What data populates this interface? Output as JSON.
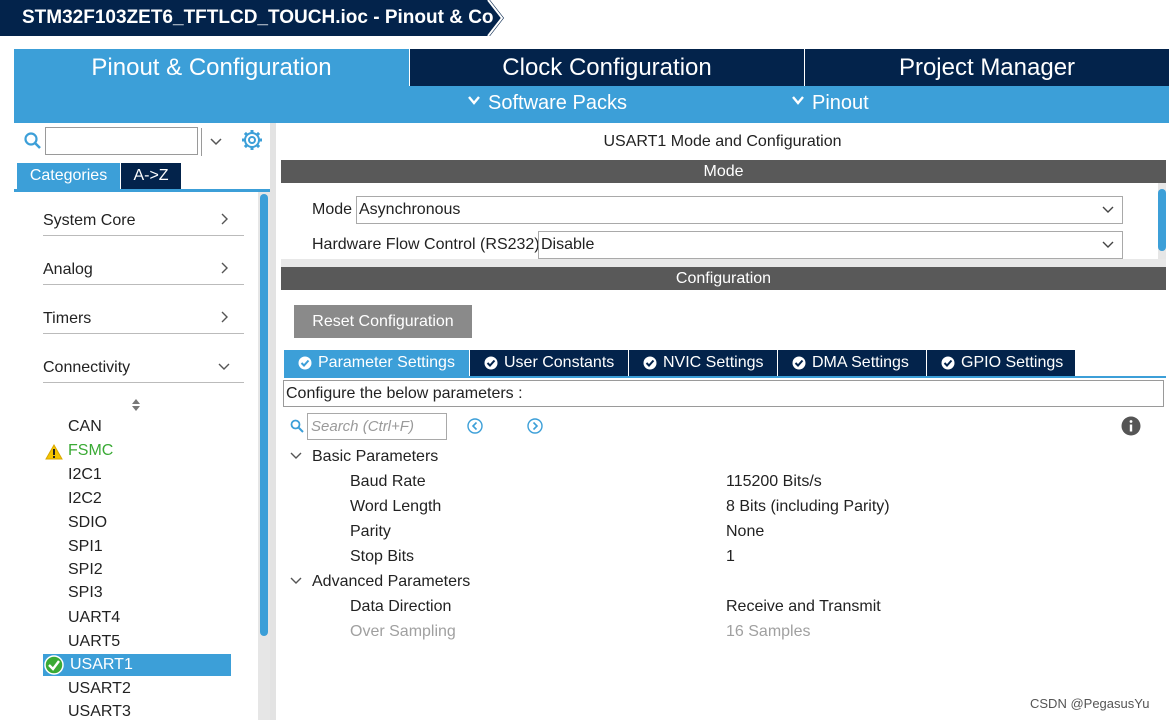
{
  "window": {
    "title": "STM32F103ZET6_TFTLCD_TOUCH.ioc - Pinout & Co"
  },
  "main_tabs": [
    {
      "label": "Pinout & Configuration",
      "active": true
    },
    {
      "label": "Clock Configuration",
      "active": false
    },
    {
      "label": "Project Manager",
      "active": false
    }
  ],
  "sub_bar": {
    "software_packs": "Software Packs",
    "pinout": "Pinout"
  },
  "left_panel": {
    "search_value": "",
    "tabs": {
      "categories": "Categories",
      "az": "A->Z"
    },
    "categories": [
      {
        "label": "System Core",
        "expanded": false
      },
      {
        "label": "Analog",
        "expanded": false
      },
      {
        "label": "Timers",
        "expanded": false
      },
      {
        "label": "Connectivity",
        "expanded": true
      }
    ],
    "connectivity_items": [
      {
        "label": "CAN",
        "status": "none"
      },
      {
        "label": "FSMC",
        "status": "warning"
      },
      {
        "label": "I2C1",
        "status": "none"
      },
      {
        "label": "I2C2",
        "status": "none"
      },
      {
        "label": "SDIO",
        "status": "none"
      },
      {
        "label": "SPI1",
        "status": "none"
      },
      {
        "label": "SPI2",
        "status": "none"
      },
      {
        "label": "SPI3",
        "status": "none"
      },
      {
        "label": "UART4",
        "status": "none"
      },
      {
        "label": "UART5",
        "status": "none"
      },
      {
        "label": "USART1",
        "status": "enabled"
      },
      {
        "label": "USART2",
        "status": "none"
      },
      {
        "label": "USART3",
        "status": "none"
      }
    ]
  },
  "config": {
    "title": "USART1 Mode and Configuration",
    "mode_header": "Mode",
    "mode_label": "Mode",
    "mode_value": "Asynchronous",
    "hfc_label": "Hardware Flow Control (RS232)",
    "hfc_value": "Disable",
    "configuration_header": "Configuration",
    "reset_button": "Reset Configuration",
    "tabs": [
      {
        "label": "Parameter Settings",
        "active": true
      },
      {
        "label": "User Constants",
        "active": false
      },
      {
        "label": "NVIC Settings",
        "active": false
      },
      {
        "label": "DMA Settings",
        "active": false
      },
      {
        "label": "GPIO Settings",
        "active": false
      }
    ],
    "params_caption": "Configure the below parameters :",
    "search_placeholder": "Search (Ctrl+F)",
    "groups": [
      {
        "label": "Basic Parameters",
        "params": [
          {
            "name": "Baud Rate",
            "value": "115200 Bits/s",
            "disabled": false
          },
          {
            "name": "Word Length",
            "value": "8 Bits (including Parity)",
            "disabled": false
          },
          {
            "name": "Parity",
            "value": "None",
            "disabled": false
          },
          {
            "name": "Stop Bits",
            "value": "1",
            "disabled": false
          }
        ]
      },
      {
        "label": "Advanced Parameters",
        "params": [
          {
            "name": "Data Direction",
            "value": "Receive and Transmit",
            "disabled": false
          },
          {
            "name": "Over Sampling",
            "value": "16 Samples",
            "disabled": true
          }
        ]
      }
    ]
  },
  "watermark": "CSDN @PegasusYu",
  "colors": {
    "accent": "#3c9fd8",
    "dark": "#03234b",
    "section": "#595959",
    "warning": "#f5c400",
    "ok": "#3aaa35"
  }
}
